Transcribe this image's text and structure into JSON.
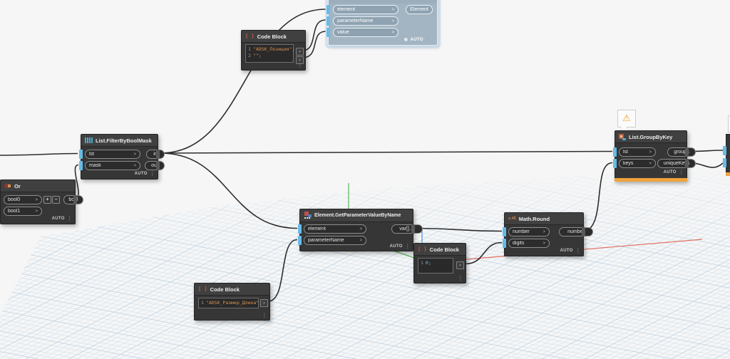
{
  "app": {
    "name": "Dynamo visual programming canvas"
  },
  "colors": {
    "background": "#f6f6f6",
    "grid_minor": "#cfdfee",
    "grid_major": "#b7cfe2",
    "wire": "#1d1d1d",
    "node_background": "#363636",
    "port_connector_blue": "#66bce6",
    "selection_fill": "#a3b4c2",
    "warning_orange": "#f0a23c",
    "axis_x_red": "#e06e60",
    "axis_y_green": "#58b658",
    "axis_z_blue": "#4f8fd6",
    "code_string_orange": "#d9904f",
    "code_number_blue": "#8ab8d8"
  },
  "ui": {
    "chevron": ">",
    "menu_icon": "⋮",
    "lacing": "AUTO",
    "freeze_icon": "❄",
    "warning_icon": "⚠",
    "add": "+",
    "remove": "−",
    "code_icon": "[ ]",
    "math_icon": "x.45"
  },
  "nodes": {
    "setParam": {
      "inputs": [
        "element",
        "parameterName",
        "value"
      ],
      "output": "Element"
    },
    "codeBlockTop": {
      "title": "Code Block",
      "lines": [
        {
          "num": "1",
          "code": "\"ADSK_Позиция\";"
        },
        {
          "num": "2",
          "code": "\"\";"
        }
      ]
    },
    "filter": {
      "title": "List.FilterByBoolMask",
      "inputs": [
        "lst",
        "mask"
      ],
      "outputs": [
        "in",
        "out"
      ]
    },
    "orNode": {
      "title": "Or",
      "inputs": [
        "bool0",
        "bool1"
      ],
      "output": "bool"
    },
    "getParam": {
      "title": "Element.GetParameterValueByName",
      "inputs": [
        "element",
        "parameterName"
      ],
      "output": "var[]..[]"
    },
    "mathRound": {
      "title": "Math.Round",
      "inputs": [
        "number",
        "digits"
      ],
      "output": "number"
    },
    "codeBlockZero": {
      "title": "Code Block",
      "lines": [
        {
          "num": "1",
          "code": "0;"
        }
      ]
    },
    "codeBlockName": {
      "title": "Code Block",
      "lines": [
        {
          "num": "1",
          "code": "\"ADSK_Размер_Длина\";"
        }
      ]
    },
    "groupByKey": {
      "title": "List.GroupByKey",
      "inputs": [
        "lst",
        "keys"
      ],
      "outputs": [
        "groups",
        "uniqueKeys"
      ]
    }
  }
}
